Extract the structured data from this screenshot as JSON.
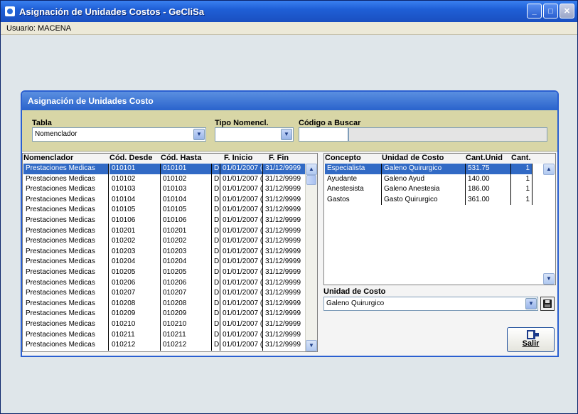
{
  "window": {
    "title": "Asignación de Unidades Costos - GeCliSa",
    "menubar_user": "Usuario: MACENA"
  },
  "panel": {
    "title": "Asignación de Unidades Costo"
  },
  "filters": {
    "tabla_label": "Tabla",
    "tabla_value": "Nomenclador",
    "tipo_label": "Tipo Nomencl.",
    "tipo_value": "",
    "codigo_label": "Código a Buscar",
    "codigo_value": ""
  },
  "left_grid": {
    "headers": [
      "Nomenclador",
      "Cód. Desde",
      "Cód. Hasta",
      "F. Inicio",
      "F. Fin"
    ],
    "rows": [
      [
        "Prestaciones Medicas",
        "010101",
        "010101",
        "D",
        "01/01/2007 (",
        "31/12/9999"
      ],
      [
        "Prestaciones Medicas",
        "010102",
        "010102",
        "D",
        "01/01/2007 (",
        "31/12/9999"
      ],
      [
        "Prestaciones Medicas",
        "010103",
        "010103",
        "D",
        "01/01/2007 (",
        "31/12/9999"
      ],
      [
        "Prestaciones Medicas",
        "010104",
        "010104",
        "D",
        "01/01/2007 (",
        "31/12/9999"
      ],
      [
        "Prestaciones Medicas",
        "010105",
        "010105",
        "D",
        "01/01/2007 (",
        "31/12/9999"
      ],
      [
        "Prestaciones Medicas",
        "010106",
        "010106",
        "D",
        "01/01/2007 (",
        "31/12/9999"
      ],
      [
        "Prestaciones Medicas",
        "010201",
        "010201",
        "D",
        "01/01/2007 (",
        "31/12/9999"
      ],
      [
        "Prestaciones Medicas",
        "010202",
        "010202",
        "D",
        "01/01/2007 (",
        "31/12/9999"
      ],
      [
        "Prestaciones Medicas",
        "010203",
        "010203",
        "D",
        "01/01/2007 (",
        "31/12/9999"
      ],
      [
        "Prestaciones Medicas",
        "010204",
        "010204",
        "D",
        "01/01/2007 (",
        "31/12/9999"
      ],
      [
        "Prestaciones Medicas",
        "010205",
        "010205",
        "D",
        "01/01/2007 (",
        "31/12/9999"
      ],
      [
        "Prestaciones Medicas",
        "010206",
        "010206",
        "D",
        "01/01/2007 (",
        "31/12/9999"
      ],
      [
        "Prestaciones Medicas",
        "010207",
        "010207",
        "D",
        "01/01/2007 (",
        "31/12/9999"
      ],
      [
        "Prestaciones Medicas",
        "010208",
        "010208",
        "D",
        "01/01/2007 (",
        "31/12/9999"
      ],
      [
        "Prestaciones Medicas",
        "010209",
        "010209",
        "D",
        "01/01/2007 (",
        "31/12/9999"
      ],
      [
        "Prestaciones Medicas",
        "010210",
        "010210",
        "D",
        "01/01/2007 (",
        "31/12/9999"
      ],
      [
        "Prestaciones Medicas",
        "010211",
        "010211",
        "D",
        "01/01/2007 (",
        "31/12/9999"
      ],
      [
        "Prestaciones Medicas",
        "010212",
        "010212",
        "D",
        "01/01/2007 (",
        "31/12/9999"
      ]
    ]
  },
  "right_grid": {
    "headers": [
      "Concepto",
      "Unidad de Costo",
      "Cant.Unid",
      "Cant."
    ],
    "rows": [
      [
        "Especialista",
        "Galeno Quirurgico",
        "531.75",
        "1"
      ],
      [
        "Ayudante",
        "Galeno Ayud",
        "140.00",
        "1"
      ],
      [
        "Anestesista",
        "Galeno Anestesia",
        "186.00",
        "1"
      ],
      [
        "Gastos",
        "Gasto Quirurgico",
        "361.00",
        "1"
      ]
    ]
  },
  "unidad_costo": {
    "label": "Unidad de Costo",
    "value": "Galeno Quirurgico"
  },
  "exit_button": {
    "label": "Salir"
  },
  "colors": {
    "title_blue": "#1f5fd6",
    "selection": "#316ac5",
    "filter_band": "#d8d6a6"
  }
}
